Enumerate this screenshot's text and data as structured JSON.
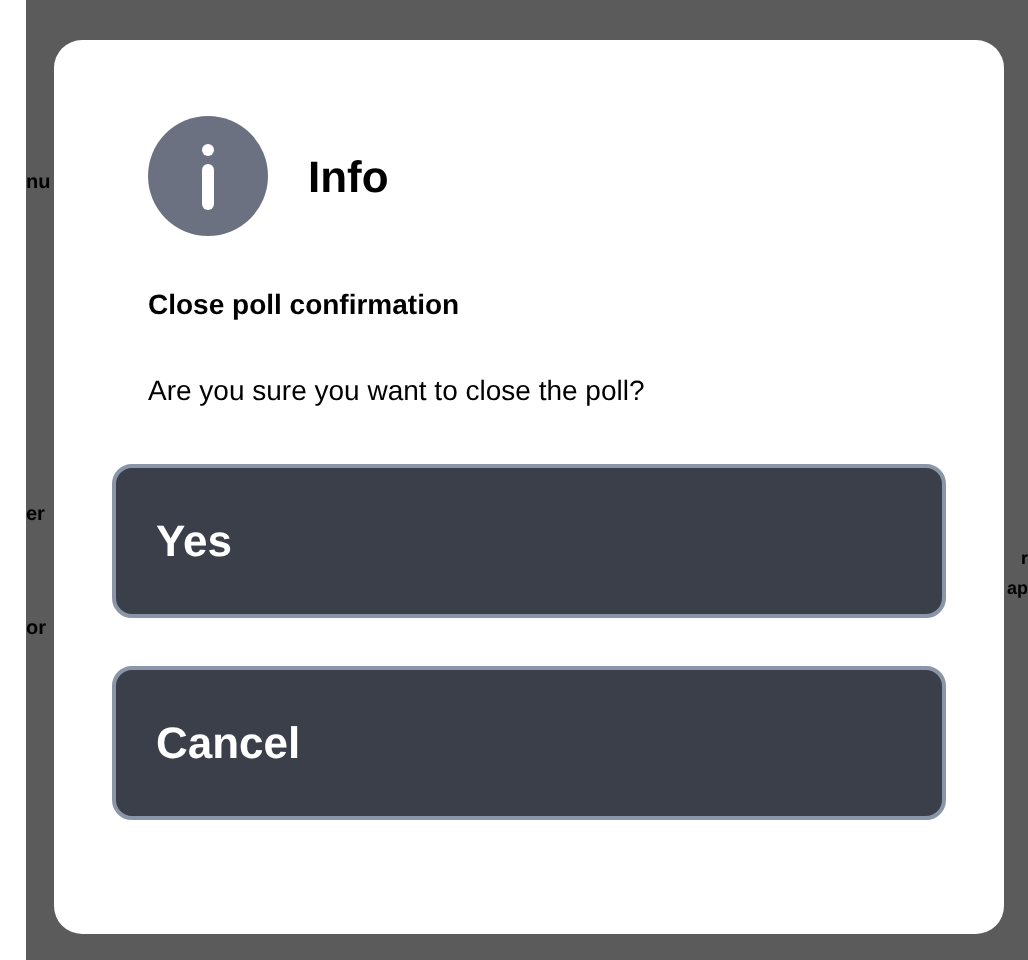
{
  "background": {
    "rows": [
      {
        "left": "nu",
        "right": ""
      },
      {
        "left": "er",
        "right": ""
      },
      {
        "left": "",
        "right": "r"
      },
      {
        "left": "",
        "right": "ap"
      },
      {
        "left": "or",
        "right": ""
      }
    ]
  },
  "dialog": {
    "title": "Info",
    "heading": "Close poll confirmation",
    "message": "Are you sure you want to close the poll?",
    "buttons": [
      {
        "label": "Yes"
      },
      {
        "label": "Cancel"
      }
    ]
  }
}
